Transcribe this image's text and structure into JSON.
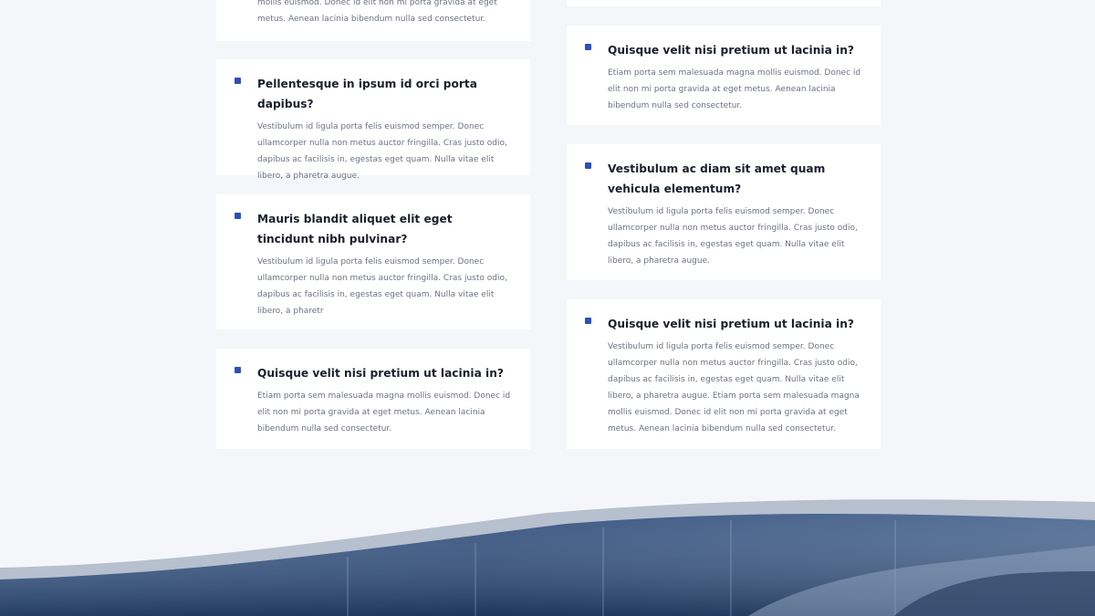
{
  "faq": {
    "left": [
      {
        "question": "",
        "answer": "mollis euismod. Donec id elit non mi porta gravida at eget metus. Aenean lacinia bibendum nulla sed consectetur."
      },
      {
        "question": "Pellentesque in ipsum id orci porta dapibus?",
        "answer": "Vestibulum id ligula porta felis euismod semper. Donec ullamcorper nulla non metus auctor fringilla. Cras justo odio, dapibus ac facilisis in, egestas eget quam. Nulla vitae elit libero, a pharetra augue."
      },
      {
        "question": "Mauris blandit aliquet elit eget tincidunt nibh pulvinar?",
        "answer": "Vestibulum id ligula porta felis euismod semper. Donec ullamcorper nulla non metus auctor fringilla. Cras justo odio, dapibus ac facilisis in, egestas eget quam. Nulla vitae elit libero, a pharetr"
      },
      {
        "question": "Quisque velit nisi pretium ut lacinia in?",
        "answer": "Etiam porta sem malesuada magna mollis euismod. Donec id elit non mi porta gravida at eget metus. Aenean lacinia bibendum nulla sed consectetur."
      }
    ],
    "right": [
      {
        "question": "Quisque velit nisi pretium ut lacinia in?",
        "answer": "Etiam porta sem malesuada magna mollis euismod. Donec id elit non mi porta gravida at eget metus. Aenean lacinia bibendum nulla sed consectetur."
      },
      {
        "question": "Vestibulum ac diam sit amet quam vehicula elementum?",
        "answer": "Vestibulum id ligula porta felis euismod semper. Donec ullamcorper nulla non metus auctor fringilla. Cras justo odio, dapibus ac facilisis in, egestas eget quam. Nulla vitae elit libero, a pharetra augue."
      },
      {
        "question": "Quisque velit nisi pretium ut lacinia in?",
        "answer": "Vestibulum id ligula porta felis euismod semper. Donec ullamcorper nulla non metus auctor fringilla. Cras justo odio, dapibus ac facilisis in, egestas eget quam. Nulla vitae elit libero, a pharetra augue. Etiam porta sem malesuada magna mollis euismod. Donec id elit non mi porta gravida at eget metus. Aenean lacinia bibendum nulla sed consectetur."
      }
    ]
  },
  "colors": {
    "page_background": "#f4f6f9",
    "card_background": "#ffffff",
    "bullet": "#2f4fb8",
    "question_text": "#1b1f2c",
    "answer_text": "#6b7280",
    "footer_wave": "#2c4a78"
  }
}
